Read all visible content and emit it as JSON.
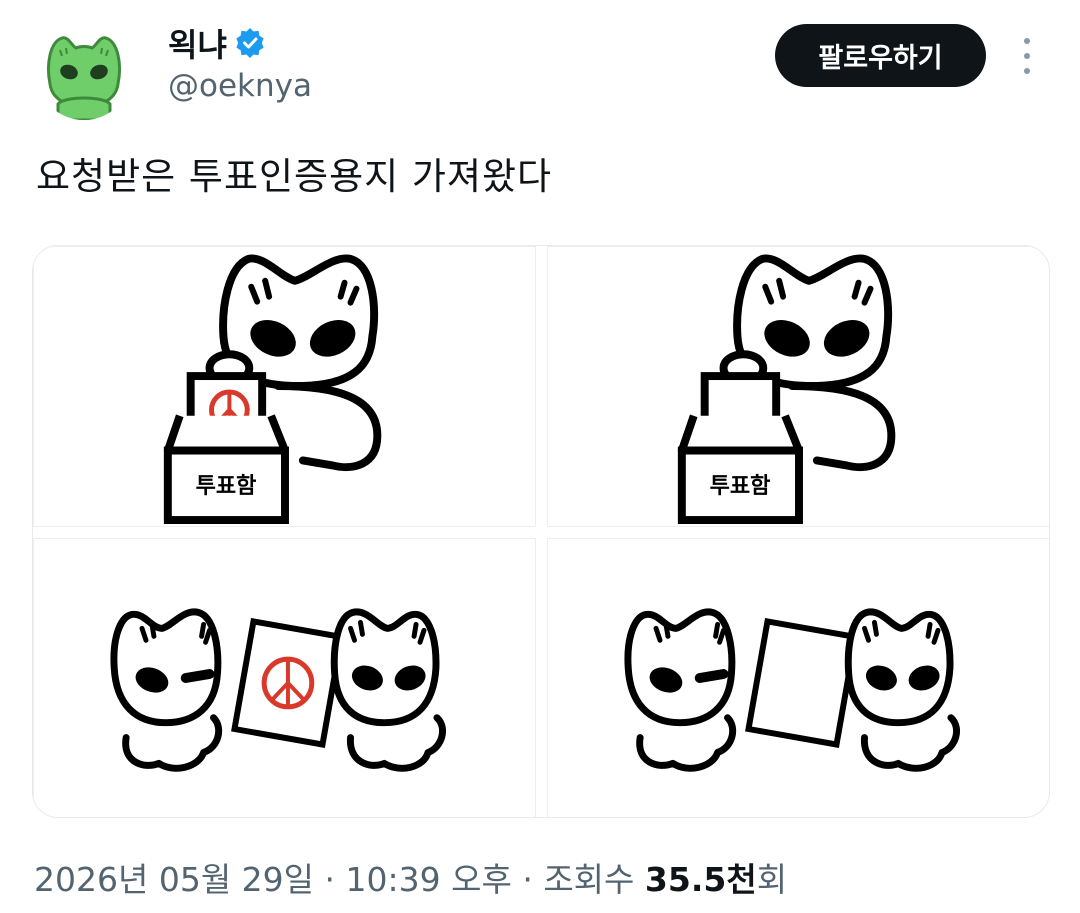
{
  "author": {
    "display_name": "왹냐",
    "handle": "@oeknya",
    "verified": true,
    "avatar_icon": "green-frog-cat-avatar"
  },
  "actions": {
    "follow_label": "팔로우하기",
    "more_icon": "vertical-ellipsis-icon"
  },
  "tweet": {
    "text": "요청받은 투표인증용지 가져왔다"
  },
  "media": {
    "images": [
      {
        "box_label": "투표함",
        "stamp": true
      },
      {
        "box_label": "투표함",
        "stamp": false
      },
      {
        "stamp": true
      },
      {
        "stamp": false
      }
    ]
  },
  "meta": {
    "date": "2026년 05월 29일",
    "time": "10:39 오후",
    "views_label": "조회수",
    "views_count": "35.5천",
    "views_suffix": "회"
  },
  "colors": {
    "verified_blue": "#1d9bf0",
    "stamp_red": "#d9392b",
    "avatar_green": "#6fce6a"
  }
}
